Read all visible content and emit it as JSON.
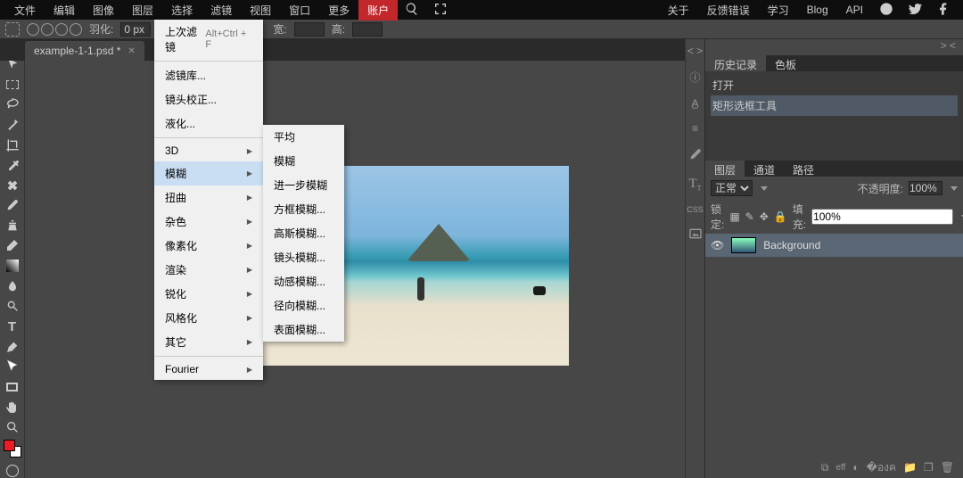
{
  "menubar": {
    "items": [
      "文件",
      "编辑",
      "图像",
      "图层",
      "选择",
      "滤镜",
      "视图",
      "窗口",
      "更多"
    ],
    "account": "账户",
    "right_links": [
      "关于",
      "反馈错误",
      "学习",
      "Blog",
      "API"
    ]
  },
  "toolbar": {
    "feather_label": "羽化:",
    "feather_value": "0 px",
    "width_label": "宽:",
    "width_value": "",
    "height_label": "高:",
    "height_value": ""
  },
  "doc_tab": {
    "name": "example-1-1.psd *"
  },
  "filter_menu": {
    "last_filter": "上次滤镜",
    "last_filter_shortcut": "Alt+Ctrl + F",
    "filter_gallery": "滤镜库...",
    "lens_correction": "镜头校正...",
    "liquify": "液化...",
    "groups": [
      "3D",
      "模糊",
      "扭曲",
      "杂色",
      "像素化",
      "渲染",
      "锐化",
      "风格化",
      "其它",
      "Fourier"
    ]
  },
  "blur_submenu": [
    "平均",
    "模糊",
    "进一步模糊",
    "方框模糊...",
    "高斯模糊...",
    "镜头模糊...",
    "动感模糊...",
    "径向模糊...",
    "表面模糊..."
  ],
  "right": {
    "history_tab": "历史记录",
    "swatches_tab": "色板",
    "history_items": [
      "打开",
      "矩形选框工具"
    ],
    "layers_tab": "图层",
    "channels_tab": "通道",
    "paths_tab": "路径",
    "blend_mode": "正常",
    "opacity_label": "不透明度:",
    "opacity_value": "100%",
    "lock_label": "锁定:",
    "fill_label": "填充:",
    "fill_value": "100%",
    "layer_name": "Background"
  },
  "right_col_top": "< >",
  "right_col_top2": "> <"
}
